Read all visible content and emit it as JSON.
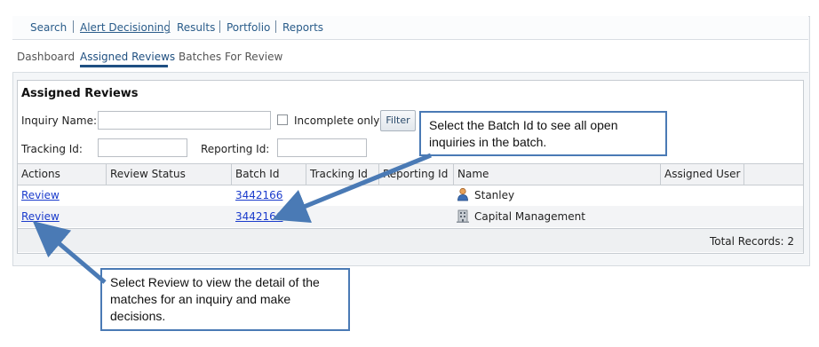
{
  "topnav": {
    "items": [
      {
        "label": "Search"
      },
      {
        "label": "Alert Decisioning"
      },
      {
        "label": "Results"
      },
      {
        "label": "Portfolio"
      },
      {
        "label": "Reports"
      }
    ]
  },
  "subnav": {
    "tabs": [
      {
        "label": "Dashboard"
      },
      {
        "label": "Assigned Reviews"
      },
      {
        "label": "Batches For Review"
      }
    ],
    "active": "Assigned Reviews"
  },
  "panel": {
    "title": "Assigned Reviews",
    "filters": {
      "inquiry_name_label": "Inquiry Name:",
      "inquiry_name_value": "",
      "incomplete_only_label": "Incomplete only",
      "incomplete_only_checked": false,
      "filter_button": "Filter",
      "tracking_id_label": "Tracking Id:",
      "tracking_id_value": "",
      "reporting_id_label": "Reporting Id:",
      "reporting_id_value": ""
    },
    "table": {
      "columns": [
        "Actions",
        "Review Status",
        "Batch Id",
        "Tracking Id",
        "Reporting Id",
        "Name",
        "Assigned User"
      ],
      "rows": [
        {
          "action": "Review",
          "review_status": "",
          "batch_id": "3442166",
          "tracking_id": "",
          "reporting_id": "",
          "name": "Stanley",
          "name_icon": "person-icon",
          "assigned_user": ""
        },
        {
          "action": "Review",
          "review_status": "",
          "batch_id": "3442166",
          "tracking_id": "",
          "reporting_id": "",
          "name": "Capital Management",
          "name_icon": "building-icon",
          "assigned_user": ""
        }
      ],
      "total_records": "Total Records: 2"
    }
  },
  "callouts": {
    "batch": "Select the Batch Id to see all open inquiries in the batch.",
    "review": "Select Review to view the detail of the matches for an inquiry and make decisions."
  },
  "colors": {
    "accent": "#1e4f82",
    "link": "#1a3bcc",
    "callout_border": "#4a7ab5",
    "arrow": "#4a7ab5"
  }
}
